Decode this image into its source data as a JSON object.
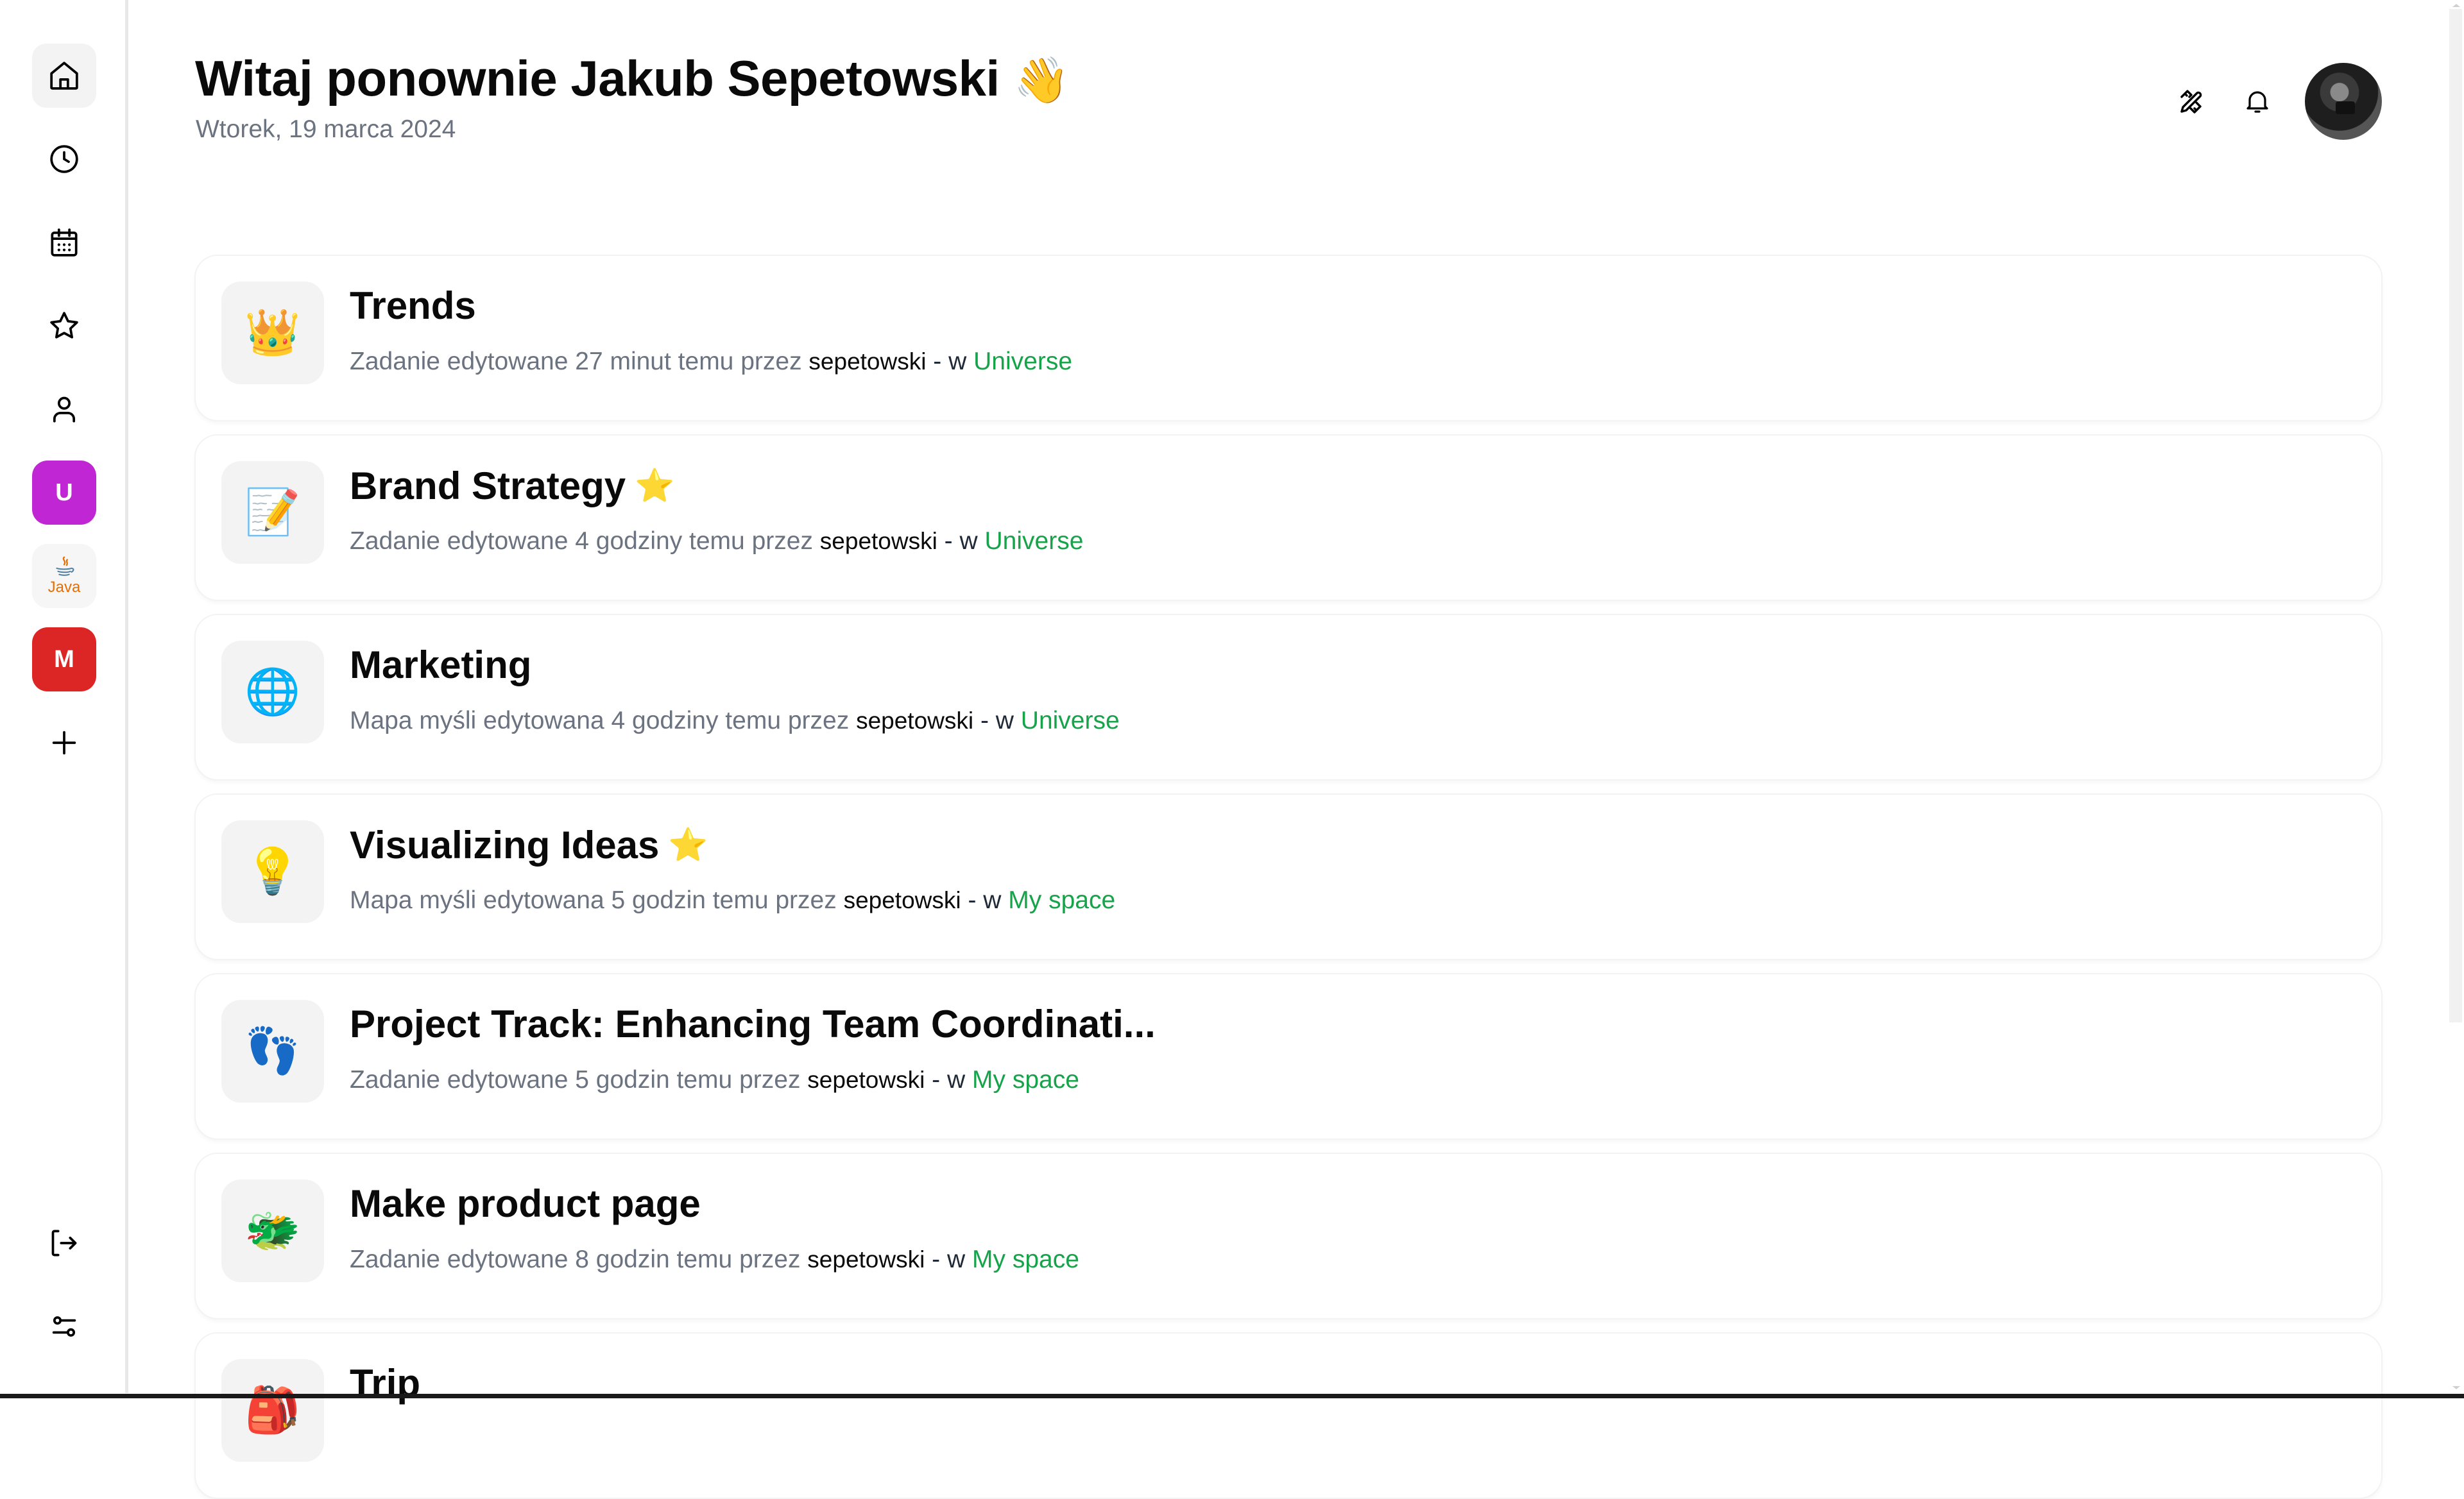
{
  "sidebar": {
    "nav": [
      {
        "id": "home",
        "icon": "home-icon",
        "active": true
      },
      {
        "id": "recent",
        "icon": "clock-icon",
        "active": false
      },
      {
        "id": "calendar",
        "icon": "calendar-icon",
        "active": false
      },
      {
        "id": "favorites",
        "icon": "star-icon",
        "active": false
      },
      {
        "id": "profile",
        "icon": "user-icon",
        "active": false
      }
    ],
    "spaces": [
      {
        "label": "U",
        "color": "#C026D3"
      },
      {
        "label": "Java",
        "color": "#F6F6F6"
      },
      {
        "label": "M",
        "color": "#DC2626"
      }
    ],
    "add_space_icon": "plus-icon",
    "bottom": [
      {
        "id": "logout",
        "icon": "logout-icon"
      },
      {
        "id": "settings",
        "icon": "sliders-icon"
      }
    ]
  },
  "header": {
    "title": "Witaj ponownie Jakub Sepetowski",
    "title_emoji": "👋",
    "date": "Wtorek, 19 marca 2024",
    "icons": [
      "tools-icon",
      "bell-icon"
    ],
    "avatar": "user-avatar"
  },
  "colors": {
    "space_link": "#16A34A",
    "muted_text": "#6B7280",
    "favorite_star": "#FCD34D"
  },
  "items": [
    {
      "title": "Trends",
      "emoji": "👑",
      "favorite": false,
      "action": "Zadanie edytowane 27 minut temu przez",
      "user": "sepetowski",
      "in": "- w",
      "space": "Universe"
    },
    {
      "title": "Brand Strategy",
      "emoji": "📝",
      "favorite": true,
      "action": "Zadanie edytowane 4 godziny temu przez",
      "user": "sepetowski",
      "in": "- w",
      "space": "Universe"
    },
    {
      "title": "Marketing",
      "emoji": "🌐",
      "favorite": false,
      "action": "Mapa myśli edytowana 4 godziny temu przez",
      "user": "sepetowski",
      "in": "- w",
      "space": "Universe"
    },
    {
      "title": "Visualizing Ideas",
      "emoji": "💡",
      "favorite": true,
      "action": "Mapa myśli edytowana 5 godzin temu przez",
      "user": "sepetowski",
      "in": "- w",
      "space": "My space"
    },
    {
      "title": "Project Track: Enhancing Team Coordinati...",
      "emoji": "👣",
      "favorite": false,
      "action": "Zadanie edytowane 5 godzin temu przez",
      "user": "sepetowski",
      "in": "- w",
      "space": "My space"
    },
    {
      "title": "Make product page",
      "emoji": "🐲",
      "favorite": false,
      "action": "Zadanie edytowane 8 godzin temu przez",
      "user": "sepetowski",
      "in": "- w",
      "space": "My space"
    },
    {
      "title": "Trip",
      "emoji": "🎒",
      "favorite": false,
      "action": "",
      "user": "",
      "in": "",
      "space": ""
    }
  ],
  "favorite_glyph": "⭐"
}
